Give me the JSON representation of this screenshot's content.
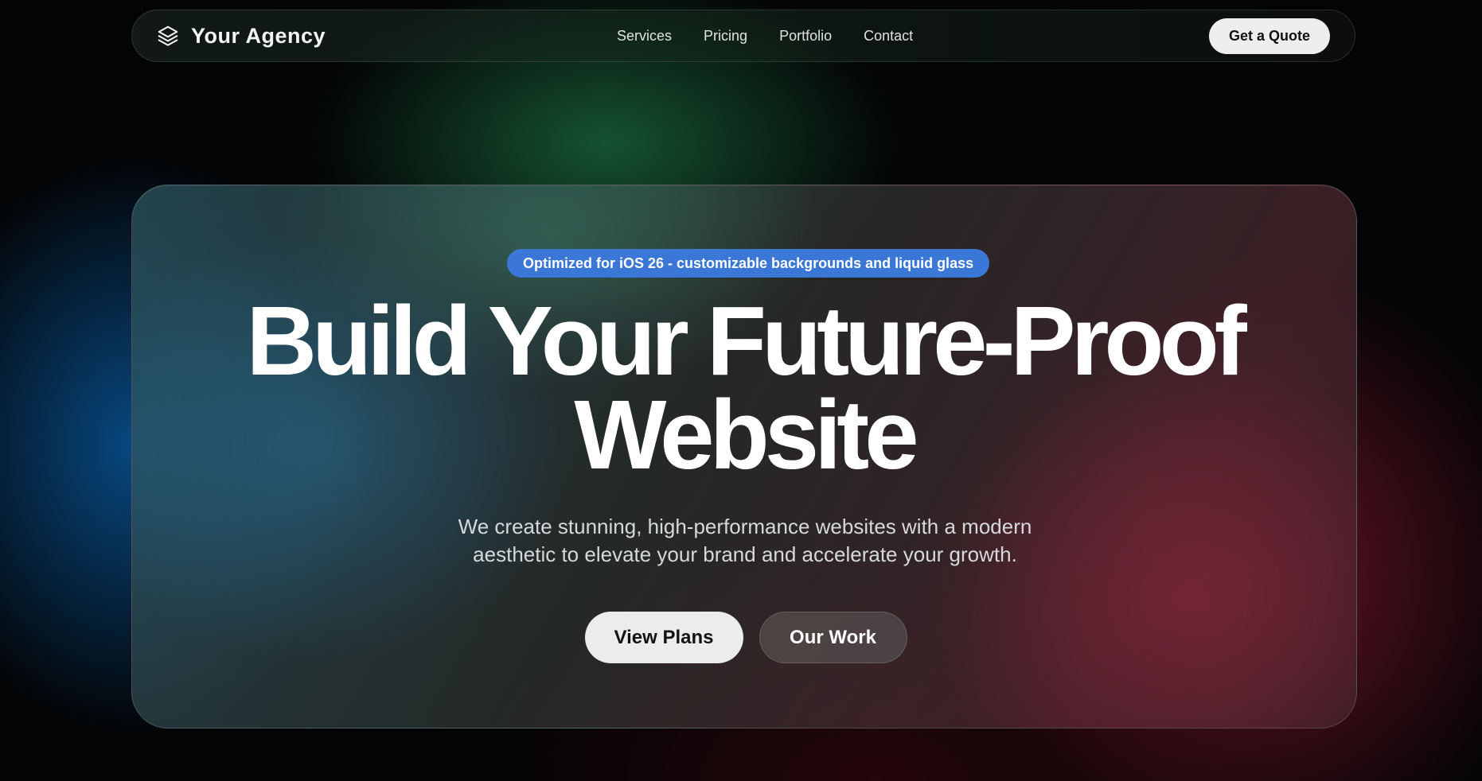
{
  "nav": {
    "brand_icon": "layers-icon",
    "brand_name": "Your Agency",
    "links": [
      "Services",
      "Pricing",
      "Portfolio",
      "Contact"
    ],
    "cta_label": "Get a Quote"
  },
  "hero": {
    "badge": "Optimized for iOS 26 - customizable backgrounds and liquid glass",
    "headline_line1": "Build Your Future-Proof",
    "headline_line2": "Website",
    "subtext_line1": "We create stunning, high-performance websites with a modern",
    "subtext_line2": "aesthetic to elevate your brand and accelerate your growth.",
    "primary_cta": "View Plans",
    "secondary_cta": "Our Work"
  },
  "colors": {
    "badge": "#3a77d6",
    "button_light": "#ececec",
    "background": "#030405"
  }
}
